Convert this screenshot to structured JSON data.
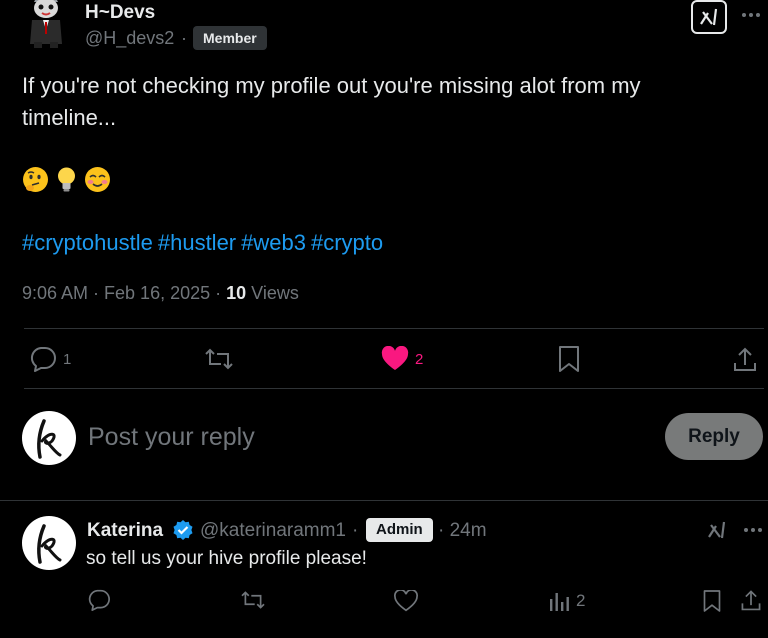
{
  "post": {
    "author_name": "H~Devs",
    "author_handle": "@H_devs2",
    "separator": "·",
    "badge": "Member",
    "text": "If you're not checking my profile out you're missing alot from my timeline...",
    "emojis": [
      "thinking-face",
      "light-bulb",
      "smiling-face-blushing"
    ],
    "hashtags": [
      "#cryptohustle",
      "#hustler",
      "#web3",
      "#crypto"
    ],
    "time": "9:06 AM · Feb 16, 2025 · ",
    "views_count": "10",
    "views_label": " Views",
    "replies": "1",
    "likes": "2"
  },
  "composer": {
    "placeholder": "Post your reply",
    "button": "Reply"
  },
  "comment": {
    "author_name": "Katerina",
    "author_handle": "@katerinaramm1",
    "separator": "·",
    "badge": "Admin",
    "time": "· 24m",
    "text": "so tell us your hive profile please!",
    "views": "2"
  },
  "colors": {
    "background": "#000000",
    "text": "#e7e9ea",
    "muted": "#71767b",
    "link": "#1d9bf0",
    "like": "#f91880",
    "divider": "#2f3336"
  }
}
